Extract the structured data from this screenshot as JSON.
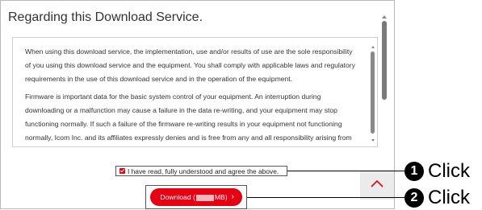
{
  "panel": {
    "title": "Regarding this Download Service."
  },
  "terms": {
    "paragraphs": [
      "When using this download service, the implementation, use and/or results of use are the sole responsibility of you using this download service and the equipment. You shall comply with applicable laws and regulatory requirements in the use of this download service and in the operation of the equipment.",
      "Firmware is important data for the basic system control of your equipment. An interruption during downloading or a malfunction may cause a failure in the data re-writing, and your equipment may stop functioning normally. If such a failure of the firmware re-writing results in your equipment not functioning normally, Icom Inc. and its affiliates expressly denies and is free from any and all responsibility arising from"
    ]
  },
  "agreement": {
    "checked": true,
    "label": "I have read, fully understood and agree the above."
  },
  "download_button": {
    "prefix": "Download (",
    "suffix": "MB)",
    "arrow": "›"
  },
  "callouts": [
    {
      "badge": "1",
      "label": "Click"
    },
    {
      "badge": "2",
      "label": "Click"
    }
  ],
  "colors": {
    "accent_red": "#e60012",
    "scroll_top_bg": "#ebebeb"
  },
  "icons": {
    "scroll_top": "chevron-up-icon",
    "checkbox": "checkbox-checked-icon"
  }
}
